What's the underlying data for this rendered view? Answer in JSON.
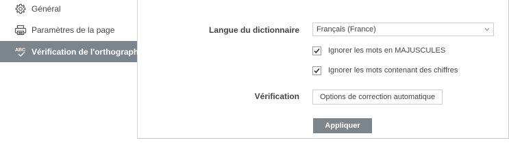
{
  "sidebar": {
    "items": [
      {
        "label": "Général",
        "icon": "gear-icon"
      },
      {
        "label": "Paramètres de la page",
        "icon": "printer-icon"
      },
      {
        "label": "Vérification de l'orthographe",
        "icon": "spellcheck-icon",
        "active": true
      }
    ]
  },
  "main": {
    "language_label": "Langue du dictionnaire",
    "language_value": "Français (France)",
    "ignore_caps_label": "Ignorer les mots en MAJUSCULES",
    "ignore_caps_checked": true,
    "ignore_digits_label": "Ignorer les mots contenant des chiffres",
    "ignore_digits_checked": true,
    "verification_label": "Vérification",
    "autocorrect_button": "Options de correction automatique",
    "apply_button": "Appliquer"
  },
  "colors": {
    "active_background": "#7d858c",
    "text": "#444444",
    "border": "#cfcfcf"
  }
}
